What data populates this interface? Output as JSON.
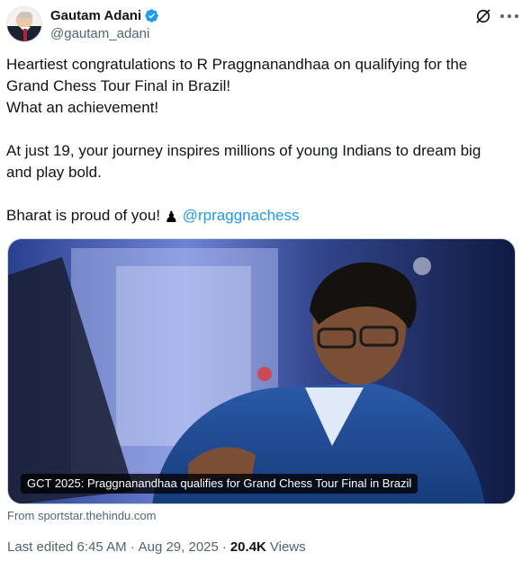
{
  "author": {
    "display_name": "Gautam Adani",
    "handle": "@gautam_adani",
    "verified_color": "#1d9bf0",
    "avatar_icon": "profile-photo"
  },
  "tweet": {
    "lines": [
      "Heartiest congratulations to R Praggnanandhaa on qualifying for the",
      "Grand Chess Tour Final in Brazil!",
      "What an achievement!",
      "At just 19, your journey inspires millions of young Indians to dream big",
      "and play bold."
    ],
    "closing_text": "Bharat is proud of you! ",
    "closing_emoji": "♟",
    "mention": "@rpraggnachess",
    "mention_color": "#1d9bf0"
  },
  "card": {
    "caption": "GCT 2025: Praggnanandhaa qualifies for Grand Chess Tour Final in Brazil",
    "source": "From sportstar.thehindu.com"
  },
  "meta": {
    "edited_time": "Last edited 6:45 AM",
    "separator": "·",
    "date": "Aug 29, 2025",
    "views_count": "20.4K",
    "views_label": "Views"
  }
}
